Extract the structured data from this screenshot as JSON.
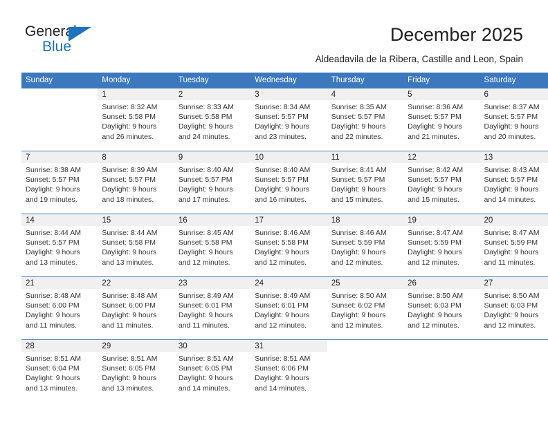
{
  "brand": {
    "word_one": "General",
    "word_two": "Blue",
    "triangle_icon": "triangle-icon",
    "primary_color": "#1b74bd"
  },
  "header": {
    "title": "December 2025",
    "subtitle": "Aldeadavila de la Ribera, Castille and Leon, Spain"
  },
  "calendar": {
    "header_bg": "#3b78bd",
    "daynum_band_bg": "#f0f0f0",
    "weekday_headers": [
      "Sunday",
      "Monday",
      "Tuesday",
      "Wednesday",
      "Thursday",
      "Friday",
      "Saturday"
    ],
    "weeks": [
      [
        {
          "day": "",
          "lines": []
        },
        {
          "day": "1",
          "lines": [
            "Sunrise: 8:32 AM",
            "Sunset: 5:58 PM",
            "Daylight: 9 hours",
            "and 26 minutes."
          ]
        },
        {
          "day": "2",
          "lines": [
            "Sunrise: 8:33 AM",
            "Sunset: 5:58 PM",
            "Daylight: 9 hours",
            "and 24 minutes."
          ]
        },
        {
          "day": "3",
          "lines": [
            "Sunrise: 8:34 AM",
            "Sunset: 5:57 PM",
            "Daylight: 9 hours",
            "and 23 minutes."
          ]
        },
        {
          "day": "4",
          "lines": [
            "Sunrise: 8:35 AM",
            "Sunset: 5:57 PM",
            "Daylight: 9 hours",
            "and 22 minutes."
          ]
        },
        {
          "day": "5",
          "lines": [
            "Sunrise: 8:36 AM",
            "Sunset: 5:57 PM",
            "Daylight: 9 hours",
            "and 21 minutes."
          ]
        },
        {
          "day": "6",
          "lines": [
            "Sunrise: 8:37 AM",
            "Sunset: 5:57 PM",
            "Daylight: 9 hours",
            "and 20 minutes."
          ]
        }
      ],
      [
        {
          "day": "7",
          "lines": [
            "Sunrise: 8:38 AM",
            "Sunset: 5:57 PM",
            "Daylight: 9 hours",
            "and 19 minutes."
          ]
        },
        {
          "day": "8",
          "lines": [
            "Sunrise: 8:39 AM",
            "Sunset: 5:57 PM",
            "Daylight: 9 hours",
            "and 18 minutes."
          ]
        },
        {
          "day": "9",
          "lines": [
            "Sunrise: 8:40 AM",
            "Sunset: 5:57 PM",
            "Daylight: 9 hours",
            "and 17 minutes."
          ]
        },
        {
          "day": "10",
          "lines": [
            "Sunrise: 8:40 AM",
            "Sunset: 5:57 PM",
            "Daylight: 9 hours",
            "and 16 minutes."
          ]
        },
        {
          "day": "11",
          "lines": [
            "Sunrise: 8:41 AM",
            "Sunset: 5:57 PM",
            "Daylight: 9 hours",
            "and 15 minutes."
          ]
        },
        {
          "day": "12",
          "lines": [
            "Sunrise: 8:42 AM",
            "Sunset: 5:57 PM",
            "Daylight: 9 hours",
            "and 15 minutes."
          ]
        },
        {
          "day": "13",
          "lines": [
            "Sunrise: 8:43 AM",
            "Sunset: 5:57 PM",
            "Daylight: 9 hours",
            "and 14 minutes."
          ]
        }
      ],
      [
        {
          "day": "14",
          "lines": [
            "Sunrise: 8:44 AM",
            "Sunset: 5:57 PM",
            "Daylight: 9 hours",
            "and 13 minutes."
          ]
        },
        {
          "day": "15",
          "lines": [
            "Sunrise: 8:44 AM",
            "Sunset: 5:58 PM",
            "Daylight: 9 hours",
            "and 13 minutes."
          ]
        },
        {
          "day": "16",
          "lines": [
            "Sunrise: 8:45 AM",
            "Sunset: 5:58 PM",
            "Daylight: 9 hours",
            "and 12 minutes."
          ]
        },
        {
          "day": "17",
          "lines": [
            "Sunrise: 8:46 AM",
            "Sunset: 5:58 PM",
            "Daylight: 9 hours",
            "and 12 minutes."
          ]
        },
        {
          "day": "18",
          "lines": [
            "Sunrise: 8:46 AM",
            "Sunset: 5:59 PM",
            "Daylight: 9 hours",
            "and 12 minutes."
          ]
        },
        {
          "day": "19",
          "lines": [
            "Sunrise: 8:47 AM",
            "Sunset: 5:59 PM",
            "Daylight: 9 hours",
            "and 12 minutes."
          ]
        },
        {
          "day": "20",
          "lines": [
            "Sunrise: 8:47 AM",
            "Sunset: 5:59 PM",
            "Daylight: 9 hours",
            "and 11 minutes."
          ]
        }
      ],
      [
        {
          "day": "21",
          "lines": [
            "Sunrise: 8:48 AM",
            "Sunset: 6:00 PM",
            "Daylight: 9 hours",
            "and 11 minutes."
          ]
        },
        {
          "day": "22",
          "lines": [
            "Sunrise: 8:48 AM",
            "Sunset: 6:00 PM",
            "Daylight: 9 hours",
            "and 11 minutes."
          ]
        },
        {
          "day": "23",
          "lines": [
            "Sunrise: 8:49 AM",
            "Sunset: 6:01 PM",
            "Daylight: 9 hours",
            "and 11 minutes."
          ]
        },
        {
          "day": "24",
          "lines": [
            "Sunrise: 8:49 AM",
            "Sunset: 6:01 PM",
            "Daylight: 9 hours",
            "and 12 minutes."
          ]
        },
        {
          "day": "25",
          "lines": [
            "Sunrise: 8:50 AM",
            "Sunset: 6:02 PM",
            "Daylight: 9 hours",
            "and 12 minutes."
          ]
        },
        {
          "day": "26",
          "lines": [
            "Sunrise: 8:50 AM",
            "Sunset: 6:03 PM",
            "Daylight: 9 hours",
            "and 12 minutes."
          ]
        },
        {
          "day": "27",
          "lines": [
            "Sunrise: 8:50 AM",
            "Sunset: 6:03 PM",
            "Daylight: 9 hours",
            "and 12 minutes."
          ]
        }
      ],
      [
        {
          "day": "28",
          "lines": [
            "Sunrise: 8:51 AM",
            "Sunset: 6:04 PM",
            "Daylight: 9 hours",
            "and 13 minutes."
          ]
        },
        {
          "day": "29",
          "lines": [
            "Sunrise: 8:51 AM",
            "Sunset: 6:05 PM",
            "Daylight: 9 hours",
            "and 13 minutes."
          ]
        },
        {
          "day": "30",
          "lines": [
            "Sunrise: 8:51 AM",
            "Sunset: 6:05 PM",
            "Daylight: 9 hours",
            "and 14 minutes."
          ]
        },
        {
          "day": "31",
          "lines": [
            "Sunrise: 8:51 AM",
            "Sunset: 6:06 PM",
            "Daylight: 9 hours",
            "and 14 minutes."
          ]
        },
        {
          "day": "",
          "lines": []
        },
        {
          "day": "",
          "lines": []
        },
        {
          "day": "",
          "lines": []
        }
      ]
    ]
  }
}
